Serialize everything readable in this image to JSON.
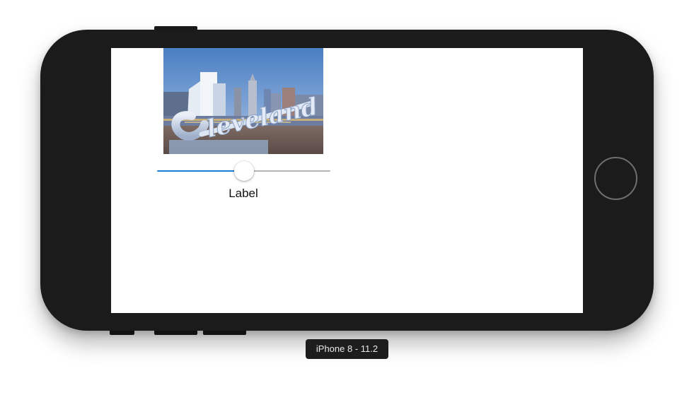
{
  "simulator": {
    "device_label": "iPhone 8 - 11.2"
  },
  "screen": {
    "image": {
      "sign_text": "Cleveland"
    },
    "slider": {
      "value": 0.5,
      "min_track_color": "#1f7ad3",
      "max_track_color": "#b5b5b5"
    },
    "label_text": "Label"
  },
  "colors": {
    "device_body": "#1b1b1b",
    "home_button_ring": "#6e6e6e"
  }
}
